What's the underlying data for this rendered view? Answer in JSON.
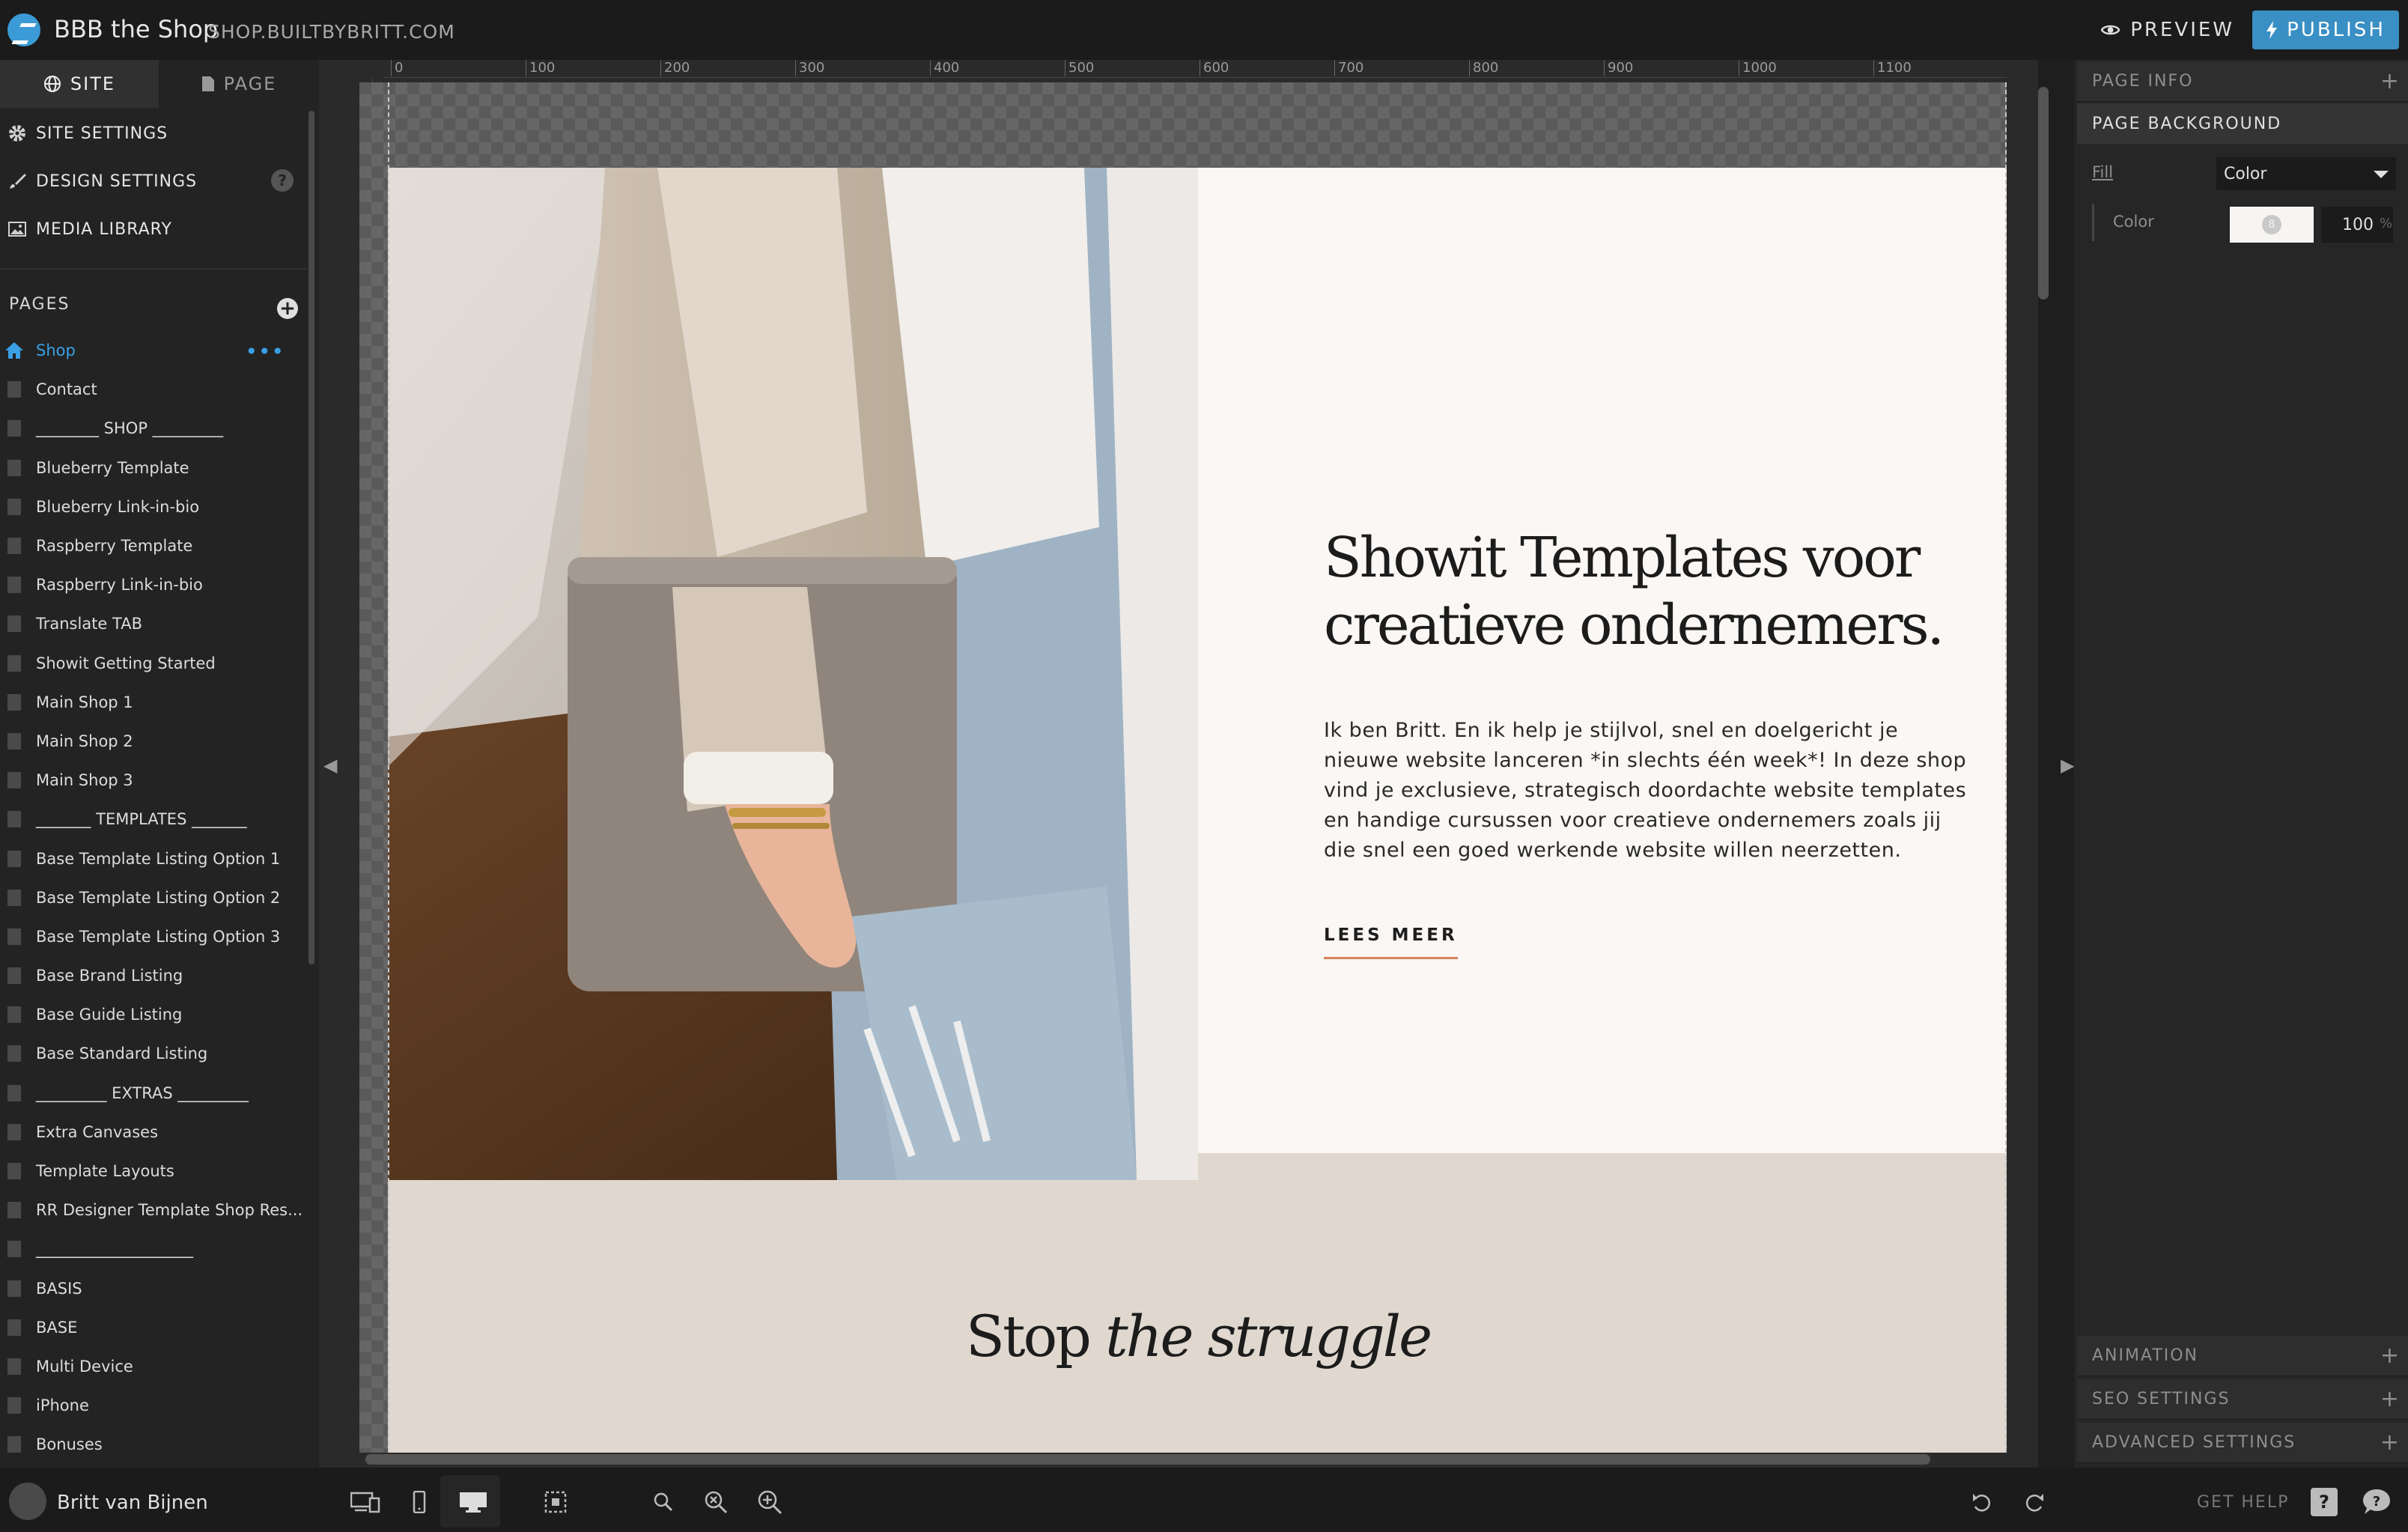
{
  "topbar": {
    "site_name": "BBB the Shop",
    "site_url": "SHOP.BUILTBYBRITT.COM",
    "preview_label": "PREVIEW",
    "publish_label": "PUBLISH"
  },
  "left_panel": {
    "tabs": [
      {
        "label": "SITE"
      },
      {
        "label": "PAGE"
      }
    ],
    "menu": [
      {
        "label": "SITE SETTINGS",
        "icon": "gear-icon"
      },
      {
        "label": "DESIGN SETTINGS",
        "icon": "brush-icon"
      },
      {
        "label": "MEDIA LIBRARY",
        "icon": "image-icon"
      }
    ],
    "help_badge": "?",
    "pages_heading": "PAGES",
    "pages": [
      "Shop",
      "Contact",
      "________ SHOP _________",
      "Blueberry Template",
      "Blueberry Link-in-bio",
      "Raspberry Template",
      "Raspberry Link-in-bio",
      "Translate TAB",
      "Showit Getting Started",
      "Main Shop 1",
      "Main Shop 2",
      "Main Shop 3",
      "_______ TEMPLATES _______",
      "Base Template Listing Option 1",
      "Base Template Listing Option 2",
      "Base Template Listing Option 3",
      "Base Brand Listing",
      "Base Guide Listing",
      "Base Standard Listing",
      "_________ EXTRAS _________",
      "Extra Canvases",
      "Template Layouts",
      "RR Designer Template Shop Res...",
      "____________________",
      "BASIS",
      "BASE",
      "Multi Device",
      "iPhone",
      "Bonuses"
    ],
    "active_page": "Shop"
  },
  "ruler": {
    "ticks": [
      "0",
      "100",
      "200",
      "300",
      "400",
      "500",
      "600",
      "700",
      "800",
      "900",
      "1000",
      "1100"
    ]
  },
  "canvas": {
    "hero_heading": "Showit Templates voor creatieve ondernemers.",
    "hero_body": "Ik ben Britt. En ik help je stijlvol, snel en doelgericht je nieuwe website lanceren *in slechts één week*! In deze shop vind je exclusieve, strategisch doordachte website templates en handige cursussen voor creatieve ondernemers zoals jij die snel een goed werkende website willen neerzetten.",
    "cta_label": "LEES MEER",
    "section2_heading_plain": "Stop ",
    "section2_heading_italic": "the struggle",
    "colors": {
      "hero_bg": "#faf7f4",
      "section2_bg": "#e0d8cf",
      "cta_underline": "#d4825a"
    }
  },
  "right_panel": {
    "page_info": "PAGE INFO",
    "page_background": "PAGE BACKGROUND",
    "fill_label": "Fill",
    "fill_value": "Color",
    "color_label": "Color",
    "opacity_value": "100",
    "opacity_unit": "%",
    "swatch_badge": "8",
    "animation": "ANIMATION",
    "seo_settings": "SEO SETTINGS",
    "advanced_settings": "ADVANCED SETTINGS"
  },
  "bottombar": {
    "user_name": "Britt van Bijnen",
    "get_help": "GET HELP",
    "help_key": "?"
  },
  "accent_color": "#3a8fc4"
}
